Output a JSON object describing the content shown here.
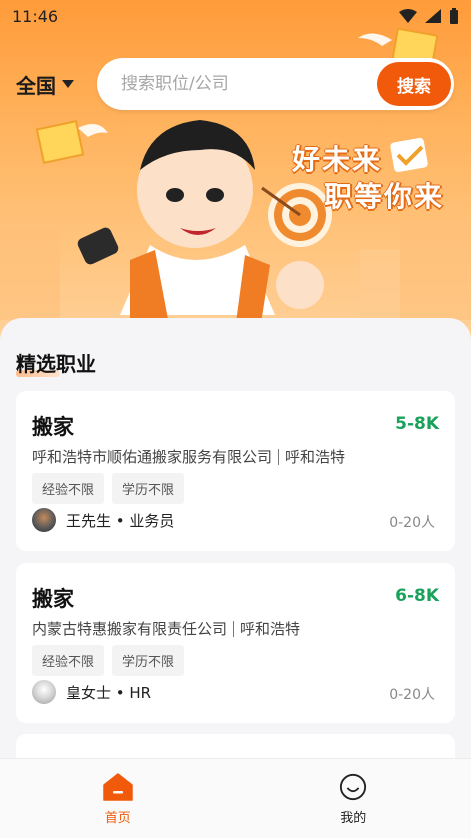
{
  "status_bar": {
    "time": "11:46"
  },
  "header": {
    "region_label": "全国",
    "search_placeholder": "搜索职位/公司",
    "search_button": "搜索"
  },
  "banner": {
    "slogan_line1": "好未来",
    "slogan_line2": "职等你来"
  },
  "section": {
    "title": "精选职业"
  },
  "jobs": [
    {
      "title": "搬家",
      "salary": "5-8K",
      "company": "呼和浩特市顺佑通搬家服务有限公司",
      "city": "呼和浩特",
      "tags": [
        "经验不限",
        "学历不限"
      ],
      "recruiter": "王先生 • 业务员",
      "company_size": "0-20人"
    },
    {
      "title": "搬家",
      "salary": "6-8K",
      "company": "内蒙古特惠搬家有限责任公司",
      "city": "呼和浩特",
      "tags": [
        "经验不限",
        "学历不限"
      ],
      "recruiter": "皇女士 • HR",
      "company_size": "0-20人"
    }
  ],
  "tabbar": {
    "items": [
      {
        "label": "首页",
        "icon": "home-icon",
        "active": true
      },
      {
        "label": "我的",
        "icon": "smiley-icon",
        "active": false
      }
    ]
  },
  "colors": {
    "accent": "#f05a0a",
    "salary": "#19a25a",
    "tab_active": "#f05a0a"
  }
}
